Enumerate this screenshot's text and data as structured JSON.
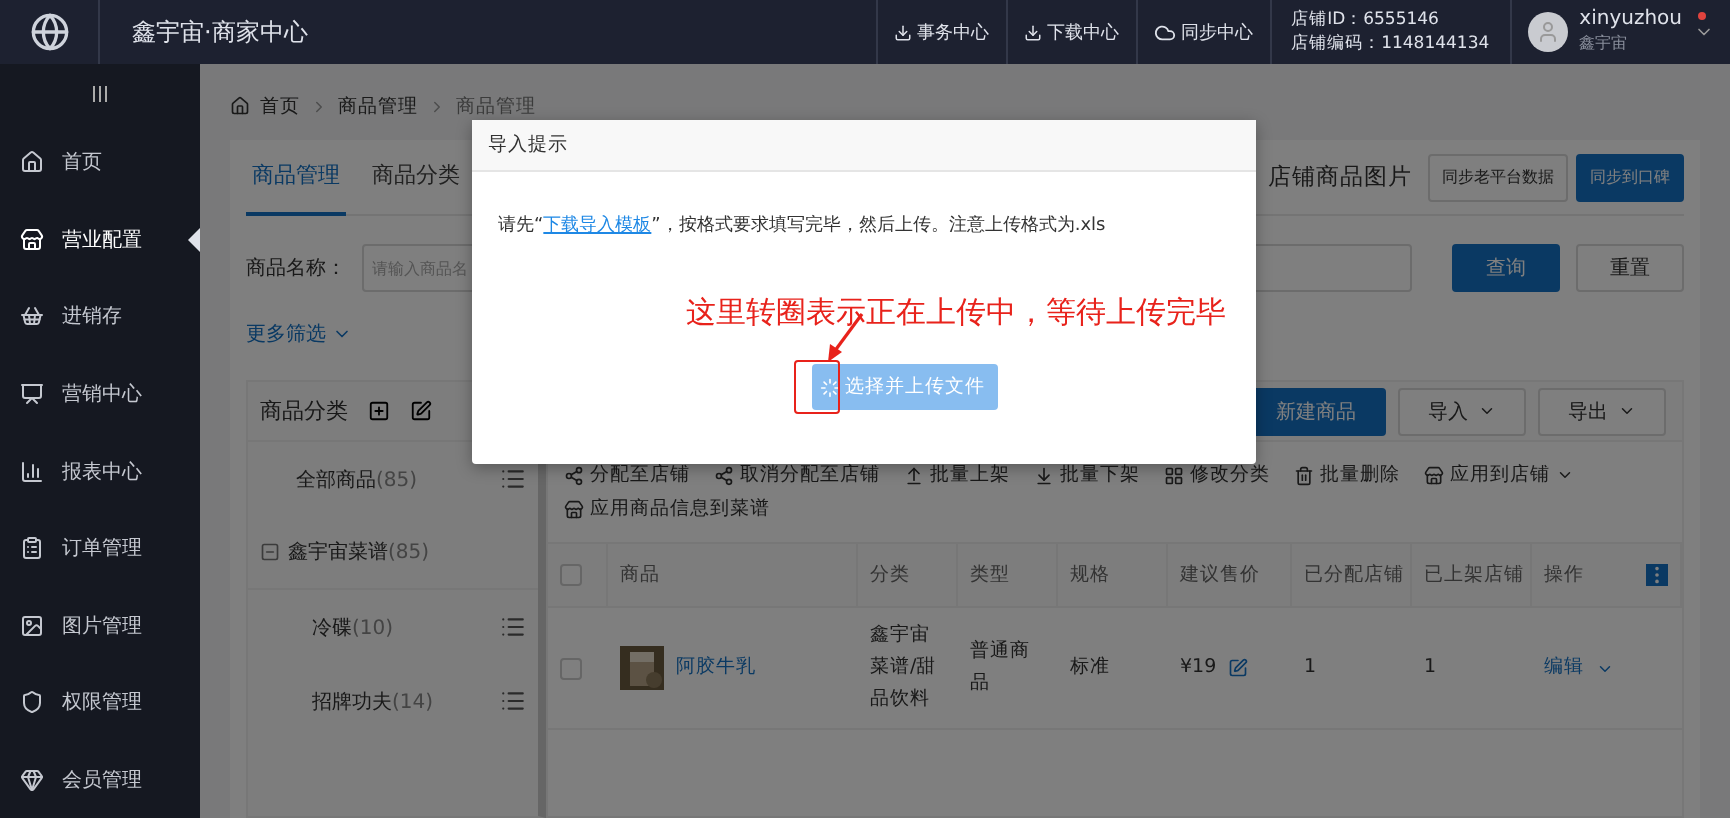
{
  "top_bar": {
    "brand": "鑫宇宙·商家中心",
    "links": [
      {
        "label": "事务中心",
        "kind": "download"
      },
      {
        "label": "下载中心",
        "kind": "download"
      },
      {
        "label": "同步中心",
        "kind": "cloud"
      }
    ],
    "store_id": "店铺ID：6555146",
    "store_code": "店铺编码：1148144134",
    "user": {
      "name": "xinyuzhou",
      "store": "鑫宇宙",
      "notification": true
    }
  },
  "sidebar": {
    "items": [
      {
        "label": "首页",
        "selected": false
      },
      {
        "label": "营业配置",
        "selected": true
      },
      {
        "label": "进销存",
        "selected": false
      },
      {
        "label": "营销中心",
        "selected": false
      },
      {
        "label": "报表中心",
        "selected": false
      },
      {
        "label": "订单管理",
        "selected": false
      },
      {
        "label": "图片管理",
        "selected": false
      },
      {
        "label": "权限管理",
        "selected": false
      },
      {
        "label": "会员管理",
        "selected": false
      }
    ]
  },
  "breadcrumb": [
    "首页",
    "商品管理",
    "商品管理"
  ],
  "tabs": [
    {
      "label": "商品管理",
      "selected": true
    },
    {
      "label": "商品分类",
      "selected": false
    }
  ],
  "images_label": "店铺商品图片",
  "header_buttons": [
    {
      "label": "同步老平台数据",
      "kind": "default"
    },
    {
      "label": "同步到口碑",
      "kind": "primary"
    }
  ],
  "search": {
    "label": "商品名称：",
    "placeholder": "请输入商品名",
    "buttons": [
      {
        "label": "查询",
        "kind": "primary"
      },
      {
        "label": "重置",
        "kind": "default"
      }
    ]
  },
  "more_filter": "更多筛选",
  "category_panel": {
    "title": "商品分类",
    "items": [
      {
        "label": "全部商品",
        "count": "(85)"
      },
      {
        "label": "鑫宇宙菜谱",
        "count": "(85)",
        "expanded": true,
        "children": [
          {
            "label": "冷碟",
            "count": "(10)"
          },
          {
            "label": "招牌功夫",
            "count": "(14)"
          }
        ]
      }
    ]
  },
  "toolbar": [
    {
      "label": "新建商品",
      "kind": "primary"
    },
    {
      "label": "导入",
      "kind": "dropdown"
    },
    {
      "label": "导出",
      "kind": "dropdown"
    }
  ],
  "actions": [
    {
      "label": "分配至店铺",
      "kind": "share"
    },
    {
      "label": "取消分配至店铺",
      "kind": "share"
    },
    {
      "label": "批量上架",
      "kind": "up"
    },
    {
      "label": "批量下架",
      "kind": "down"
    },
    {
      "label": "修改分类",
      "kind": "grid"
    },
    {
      "label": "批量删除",
      "kind": "trash"
    },
    {
      "label": "应用到店铺",
      "kind": "store_dropdown"
    },
    {
      "label": "应用商品信息到菜谱",
      "kind": "store"
    }
  ],
  "table": {
    "all_checked": false,
    "columns": [
      "商品",
      "分类",
      "类型",
      "规格",
      "建议售价",
      "已分配店铺",
      "已上架店铺",
      "操作"
    ],
    "rows": [
      {
        "checked": false,
        "name": "阿胶牛乳",
        "category": "鑫宇宙菜谱/甜品饮料",
        "type": "普通商品",
        "spec": "标准",
        "price": "¥19",
        "assigned": "1",
        "listed": "1",
        "action": "编辑"
      }
    ]
  },
  "modal": {
    "title": "导入提示",
    "message_before": "请先“",
    "link": "下载导入模板",
    "message_after": "”，按格式要求填写完毕，然后上传。注意上传格式为.xls",
    "annotation": "这里转圈表示正在上传中，等待上传完毕",
    "upload_button": {
      "label": "选择并上传文件",
      "uploading": true
    }
  }
}
